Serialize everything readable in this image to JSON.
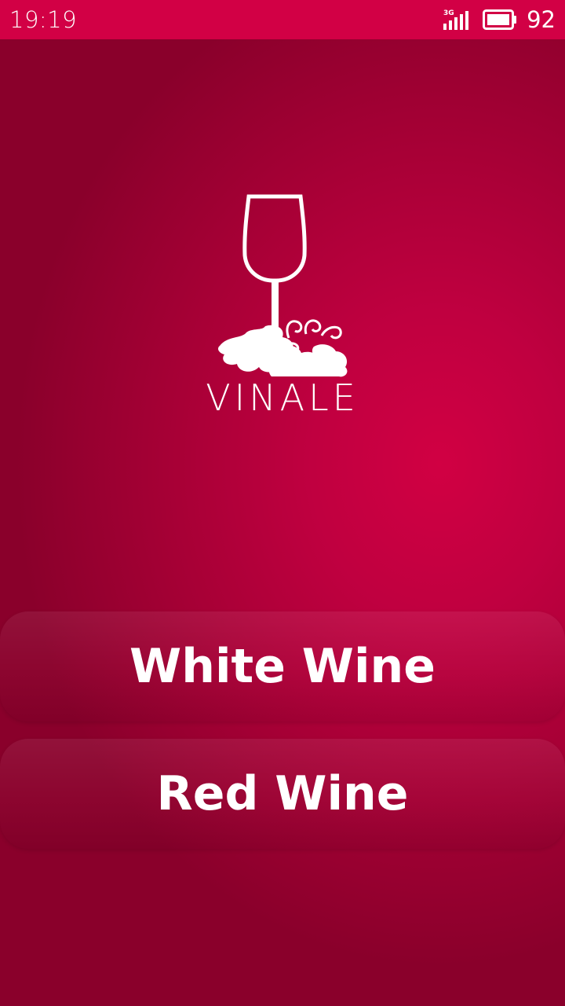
{
  "status_bar": {
    "time": "19:19",
    "network_type": "3G",
    "battery_level": "92",
    "icons": [
      "signal-icon",
      "battery-icon"
    ]
  },
  "logo": {
    "wordmark": "VINALE",
    "icon": "wine-glass-grape-leaves-icon"
  },
  "buttons": {
    "white_wine": "White Wine",
    "red_wine": "Red Wine"
  },
  "colors": {
    "status_bar": "#d20045",
    "background_center": "#d10043",
    "background_edge": "#8a002b",
    "text": "#ffffff"
  }
}
